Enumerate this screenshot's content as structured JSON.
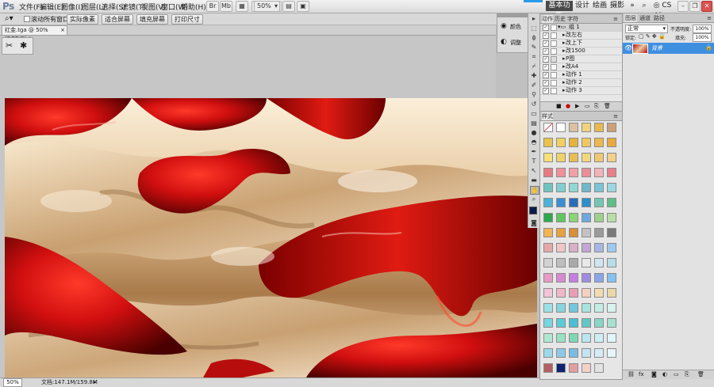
{
  "app": {
    "logo": "Ps"
  },
  "menu": [
    "文件(F)",
    "编辑(E)",
    "图像(I)",
    "图层(L)",
    "选择(S)",
    "滤镜(T)",
    "视图(V)",
    "窗口(W)",
    "帮助(H)"
  ],
  "menubar": {
    "zoom": "50%",
    "workspaces": [
      "基本功能",
      "设计",
      "绘画",
      "摄影"
    ],
    "cs_live": "CS Live"
  },
  "options_bar": {
    "scroll_all_windows": "滚动所有窗口",
    "buttons": [
      "实际像素",
      "适合屏幕",
      "填充屏幕",
      "打印尺寸"
    ]
  },
  "document": {
    "tab_title": "红金.tga @ 50%(RGB/8) *"
  },
  "status": {
    "zoom": "50%",
    "doc_size": "文档:147.1M/159.8M"
  },
  "dock": {
    "items": [
      "颜色",
      "调整"
    ]
  },
  "actions_panel": {
    "tabs": [
      "动作",
      "历史",
      "字符"
    ],
    "group": "组 1",
    "rows": [
      "改左右",
      "改上下",
      "改1500",
      "P图",
      "改A4",
      "动作 1",
      "动作 2",
      "动作 3"
    ]
  },
  "styles_panel": {
    "title": "样式"
  },
  "layers_panel": {
    "tabs": [
      "图层",
      "通道",
      "路径"
    ],
    "blend_mode": "正常",
    "opacity_label": "不透明度:",
    "opacity": "100%",
    "lock_label": "锁定:",
    "fill_label": "填充:",
    "fill": "100%",
    "layer_name": "背景"
  },
  "colors": {
    "accent_blue": "#3e8fe0",
    "gold": "#e6c9a1",
    "red": "#b80d0d"
  }
}
